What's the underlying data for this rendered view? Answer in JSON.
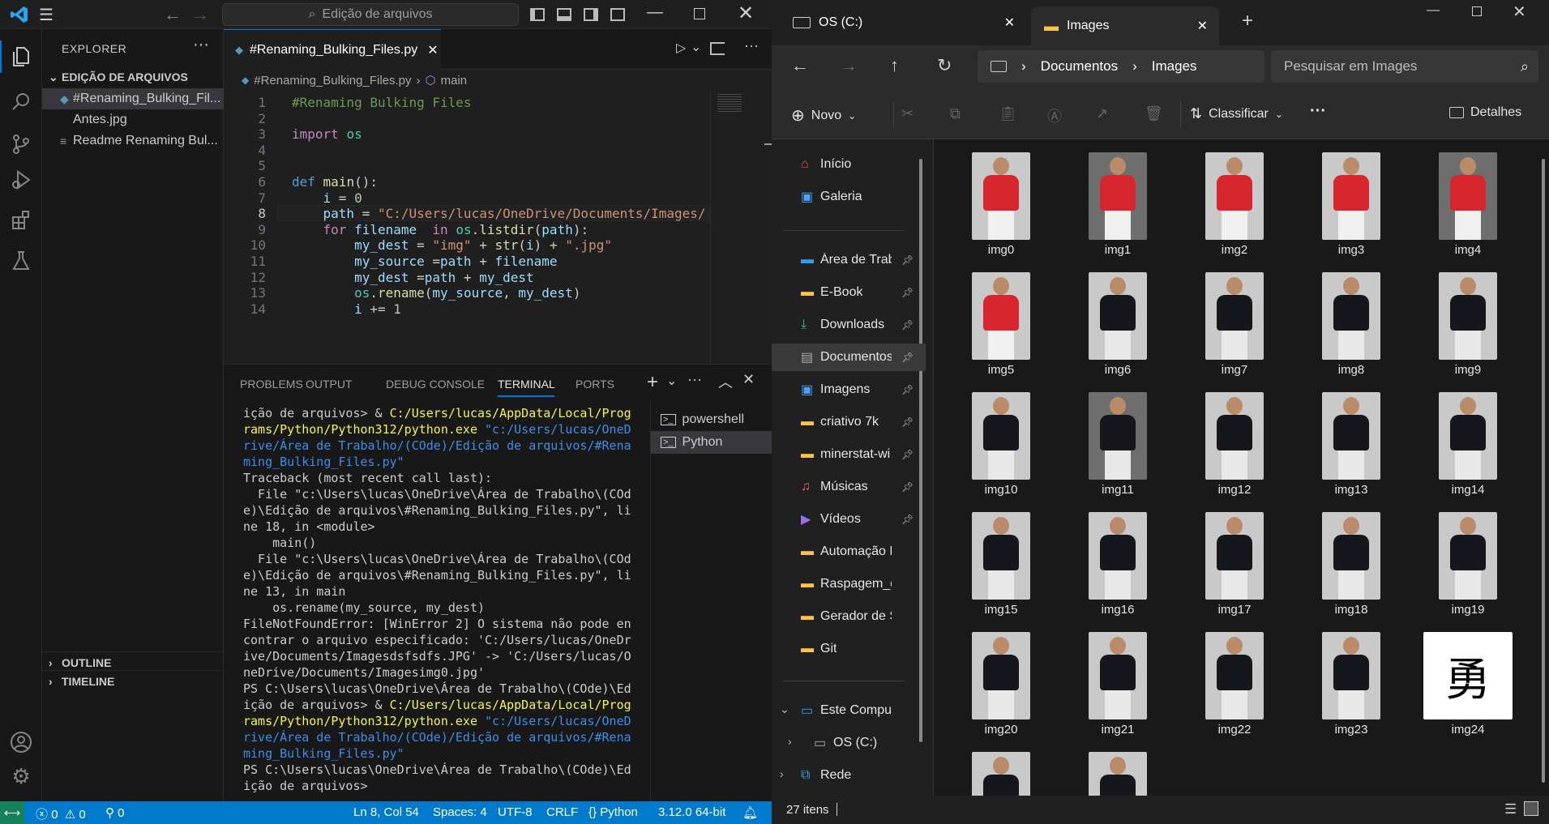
{
  "vscode": {
    "command_center": "Edição de arquivos",
    "sidebar": {
      "title": "EXPLORER",
      "folder": "EDIÇÃO DE ARQUIVOS",
      "files": [
        "#Renaming_Bulking_Fil...",
        "Antes.jpg",
        "Readme Renaming Bul..."
      ],
      "outline": "OUTLINE",
      "timeline": "TIMELINE"
    },
    "editor": {
      "tab": "#Renaming_Bulking_Files.py",
      "crumb_file": "#Renaming_Bulking_Files.py",
      "crumb_symbol": "main",
      "lines": [
        {
          "n": "1",
          "text": "#Renaming Bulking Files"
        },
        {
          "n": "2",
          "text": ""
        },
        {
          "n": "3",
          "text": "import os"
        },
        {
          "n": "4",
          "text": ""
        },
        {
          "n": "5",
          "text": ""
        },
        {
          "n": "6",
          "text": "def main():"
        },
        {
          "n": "7",
          "text": "    i = 0"
        },
        {
          "n": "8",
          "text": "    path = \"C:/Users/lucas/OneDrive/Documents/Images/"
        },
        {
          "n": "9",
          "text": "    for filename  in os.listdir(path):"
        },
        {
          "n": "10",
          "text": "        my_dest = \"img\" + str(i) + \".jpg\""
        },
        {
          "n": "11",
          "text": "        my_source =path + filename"
        },
        {
          "n": "12",
          "text": "        my_dest =path + my_dest"
        },
        {
          "n": "13",
          "text": "        os.rename(my_source, my_dest)"
        },
        {
          "n": "14",
          "text": "        i += 1"
        }
      ]
    },
    "panel": {
      "tabs": [
        "PROBLEMS",
        "OUTPUT",
        "DEBUG CONSOLE",
        "TERMINAL",
        "PORTS"
      ],
      "active_tab": "TERMINAL",
      "terminals": [
        "powershell",
        "Python"
      ],
      "output": "ição de arquivos> & C:/Users/lucas/AppData/Local/Prog\nrams/Python/Python312/python.exe \"c:/Users/lucas/OneD\nrive/Área de Trabalho/(COde)/Edição de arquivos/#Rena\nming_Bulking_Files.py\"\nTraceback (most recent call last):\n  File \"c:\\Users\\lucas\\OneDrive\\Área de Trabalho\\(COd\ne)\\Edição de arquivos\\#Renaming_Bulking_Files.py\", li\nne 18, in <module>\n    main()\n  File \"c:\\Users\\lucas\\OneDrive\\Área de Trabalho\\(COd\ne)\\Edição de arquivos\\#Renaming_Bulking_Files.py\", li\nne 13, in main\n    os.rename(my_source, my_dest)\nFileNotFoundError: [WinError 2] O sistema não pode en\ncontrar o arquivo especificado: 'C:/Users/lucas/OneDr\nive/Documents/Imagesdsfsdfs.JPG' -> 'C:/Users/lucas/O\nneDrive/Documents/Imagesimg0.jpg'\nPS C:\\Users\\lucas\\OneDrive\\Área de Trabalho\\(COde)\\Ed\nição de arquivos> & C:/Users/lucas/AppData/Local/Prog\nrams/Python/Python312/python.exe \"c:/Users/lucas/OneD\nrive/Área de Trabalho/(COde)/Edição de arquivos/#Rena\nming_Bulking_Files.py\"\nPS C:\\Users\\lucas\\OneDrive\\Área de Trabalho\\(COde)\\Ed\nição de arquivos>"
    },
    "status": {
      "errors": "0",
      "warnings": "0",
      "ports": "0",
      "position": "Ln 8, Col 54",
      "spaces": "Spaces: 4",
      "encoding": "UTF-8",
      "eol": "CRLF",
      "language": "Python",
      "interpreter": "3.12.0 64-bit"
    }
  },
  "explorer": {
    "tabs": [
      "OS (C:)",
      "Images"
    ],
    "breadcrumb": [
      "Documentos",
      "Images"
    ],
    "search_placeholder": "Pesquisar em Images",
    "cmd": {
      "new": "Novo",
      "sort": "Classificar",
      "details": "Detalhes"
    },
    "nav": {
      "top": [
        "Início",
        "Galeria"
      ],
      "pinned": [
        "Área de Trab",
        "E-Book",
        "Downloads",
        "Documentos",
        "Imagens",
        "criativo 7k",
        "minerstat-wi",
        "Músicas",
        "Vídeos"
      ],
      "folders": [
        "Automação E-m",
        "Raspagem_de_I",
        "Gerador de Sen",
        "Git"
      ],
      "pc": "Este Computador",
      "drive": "OS (C:)",
      "network": "Rede"
    },
    "files": [
      "img0",
      "img1",
      "img2",
      "img3",
      "img4",
      "img5",
      "img6",
      "img7",
      "img8",
      "img9",
      "img10",
      "img11",
      "img12",
      "img13",
      "img14",
      "img15",
      "img16",
      "img17",
      "img18",
      "img19",
      "img20",
      "img21",
      "img22",
      "img23",
      "img24",
      "",
      ""
    ],
    "kanji": "勇",
    "status": "27 itens",
    "colors": {
      "accent": "#0078d4",
      "status_bar": "#007acc"
    }
  }
}
